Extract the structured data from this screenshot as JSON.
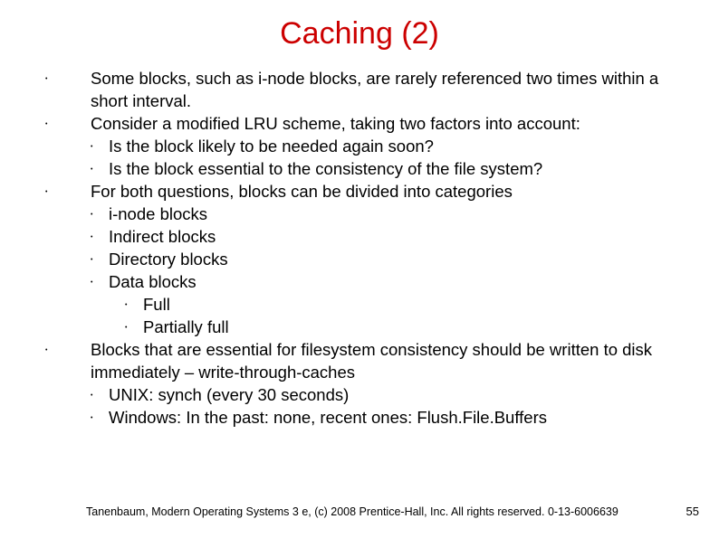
{
  "title": "Caching (2)",
  "bullets": {
    "b1": "Some blocks, such as i-node blocks, are rarely referenced two times within a short interval.",
    "b2": "Consider a modified LRU scheme, taking two factors into account:",
    "b2_1": "Is the block likely to be needed again soon?",
    "b2_2": "Is the block essential to the consistency of the file system?",
    "b3": "For both questions, blocks can be divided into categories",
    "b3_1": "i-node blocks",
    "b3_2": "Indirect blocks",
    "b3_3": "Directory blocks",
    "b3_4": "Data blocks",
    "b3_4_1": "Full",
    "b3_4_2": "Partially full",
    "b4": "Blocks that are essential for filesystem consistency should be written to disk immediately – write-through-caches",
    "b4_1": "UNIX: synch (every 30 seconds)",
    "b4_2": "Windows: In the past: none, recent ones: Flush.File.Buffers"
  },
  "footer": "Tanenbaum, Modern Operating Systems 3 e, (c) 2008 Prentice-Hall, Inc. All rights reserved. 0-13-6006639",
  "page": "55"
}
